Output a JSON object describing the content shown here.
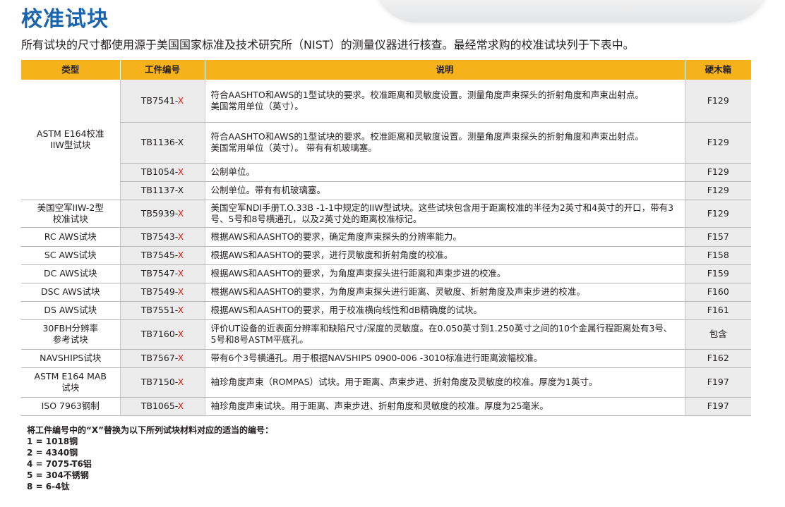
{
  "title": "校准试块",
  "intro": "所有试块的尺寸都使用源于美国国家标准及技术研究所（NIST）的测量仪器进行核查。最经常求购的校准试块列于下表中。",
  "table": {
    "headers": [
      "类型",
      "工件编号",
      "说明",
      "硬木箱"
    ],
    "rows": [
      {
        "type": "ASTM E164校准\nIIW型试块",
        "type_rowspan": 4,
        "part": "TB7541-",
        "x": "X",
        "x_red": true,
        "desc": [
          "符合AASHTO和AWS的1型试块的要求。校准距离和灵敏度设置。测量角度声束探头的折射角度和声束出射点。",
          "美国常用单位（英寸）。"
        ],
        "box": "F129"
      },
      {
        "part": "TB1136-",
        "x": "X",
        "x_red": false,
        "desc": [
          "符合AASHTO和AWS的1型试块的要求。校准距离和灵敏度设置。测量角度声束探头的折射角度和声束出射点。",
          "美国常用单位（英寸）。 带有有机玻璃塞。"
        ],
        "box": "F129"
      },
      {
        "part": "TB1054-",
        "x": "X",
        "x_red": true,
        "desc": [
          "公制单位。"
        ],
        "box": "F129"
      },
      {
        "part": "TB1137-",
        "x": "X",
        "x_red": false,
        "desc": [
          "公制单位。带有有机玻璃塞。"
        ],
        "box": "F129"
      },
      {
        "type": "美国空军IIW-2型\n校准试块",
        "type_rowspan": 1,
        "part": "TB5939-",
        "x": "X",
        "x_red": true,
        "desc": [
          "美国空军NDI手册T.O.33B -1-1中规定的IIW型试块。这些试块包含用于距离校准的半径为2英寸和4英寸的开口，带有3号、5号和8号横通孔，以及2英寸处的距离校准标记。"
        ],
        "box": "F129"
      },
      {
        "type": "RC AWS试块",
        "type_rowspan": 1,
        "part": "TB7543-",
        "x": "X",
        "x_red": true,
        "desc": [
          "根据AWS和AASHTO的要求，确定角度声束探头的分辨率能力。"
        ],
        "box": "F157"
      },
      {
        "type": "SC AWS试块",
        "type_rowspan": 1,
        "part": "TB7545-",
        "x": "X",
        "x_red": true,
        "desc": [
          "根据AWS和AASHTO的要求，进行灵敏度和折射角度的校准。"
        ],
        "box": "F158"
      },
      {
        "type": "DC AWS试块",
        "type_rowspan": 1,
        "part": "TB7547-",
        "x": "X",
        "x_red": true,
        "desc": [
          "根据AWS和AASHTO的要求，为角度声束探头进行距离和声束步进的校准。"
        ],
        "box": "F159"
      },
      {
        "type": "DSC AWS试块",
        "type_rowspan": 1,
        "part": "TB7549-",
        "x": "X",
        "x_red": true,
        "desc": [
          "根据AWS和AASHTO的要求，为角度声束探头进行距离、灵敏度、折射角度及声束步进的校准。"
        ],
        "box": "F160"
      },
      {
        "type": "DS AWS试块",
        "type_rowspan": 1,
        "part": "TB7551-",
        "x": "X",
        "x_red": true,
        "desc": [
          "根据AWS和AASHTO的要求，用于校准横向线性和dB精确度的试块。"
        ],
        "box": "F161"
      },
      {
        "type": "30FBH分辨率\n参考试块",
        "type_rowspan": 1,
        "part": "TB7160-",
        "x": "X",
        "x_red": true,
        "desc": [
          "评价UT设备的近表面分辨率和缺陷尺寸/深度的灵敏度。在0.050英寸到1.250英寸之间的10个金属行程距离处有3号、5号和8号ASTM平底孔。"
        ],
        "box": "包含"
      },
      {
        "type": "NAVSHIPS试块",
        "type_rowspan": 1,
        "part": "TB7567-",
        "x": "X",
        "x_red": true,
        "desc": [
          "带有6个3号横通孔。用于根据NAVSHIPS 0900-006 -3010标准进行距离波幅校准。"
        ],
        "box": "F162"
      },
      {
        "type": "ASTM E164 MAB\n试块",
        "type_rowspan": 1,
        "part": "TB7150-",
        "x": "X",
        "x_red": true,
        "desc": [
          "袖珍角度声束（ROMPAS）试块。用于距离、声束步进、折射角度及灵敏度的校准。厚度为1英寸。"
        ],
        "box": "F197"
      },
      {
        "type": "ISO 7963钢制",
        "type_rowspan": 1,
        "part": "TB1065-",
        "x": "X",
        "x_red": true,
        "desc": [
          "袖珍角度声束试块。用于距离、声束步进、折射角度和灵敏度的校准。厚度为25毫米。"
        ],
        "box": "F197"
      }
    ]
  },
  "footer": {
    "note": "将工件编号中的“X”替换为以下所列试块材料对应的适当的编号：",
    "materials": [
      "1 = 1018钢",
      "2 = 4340钢",
      "4 = 7075-T6铝",
      "5 = 304不锈钢",
      "8 = 6-4钛"
    ]
  },
  "colors": {
    "title": "#1a64ad",
    "header_bg": "#f5b21b",
    "x_highlight": "#e2231a",
    "alt_cell": "#ececed"
  }
}
